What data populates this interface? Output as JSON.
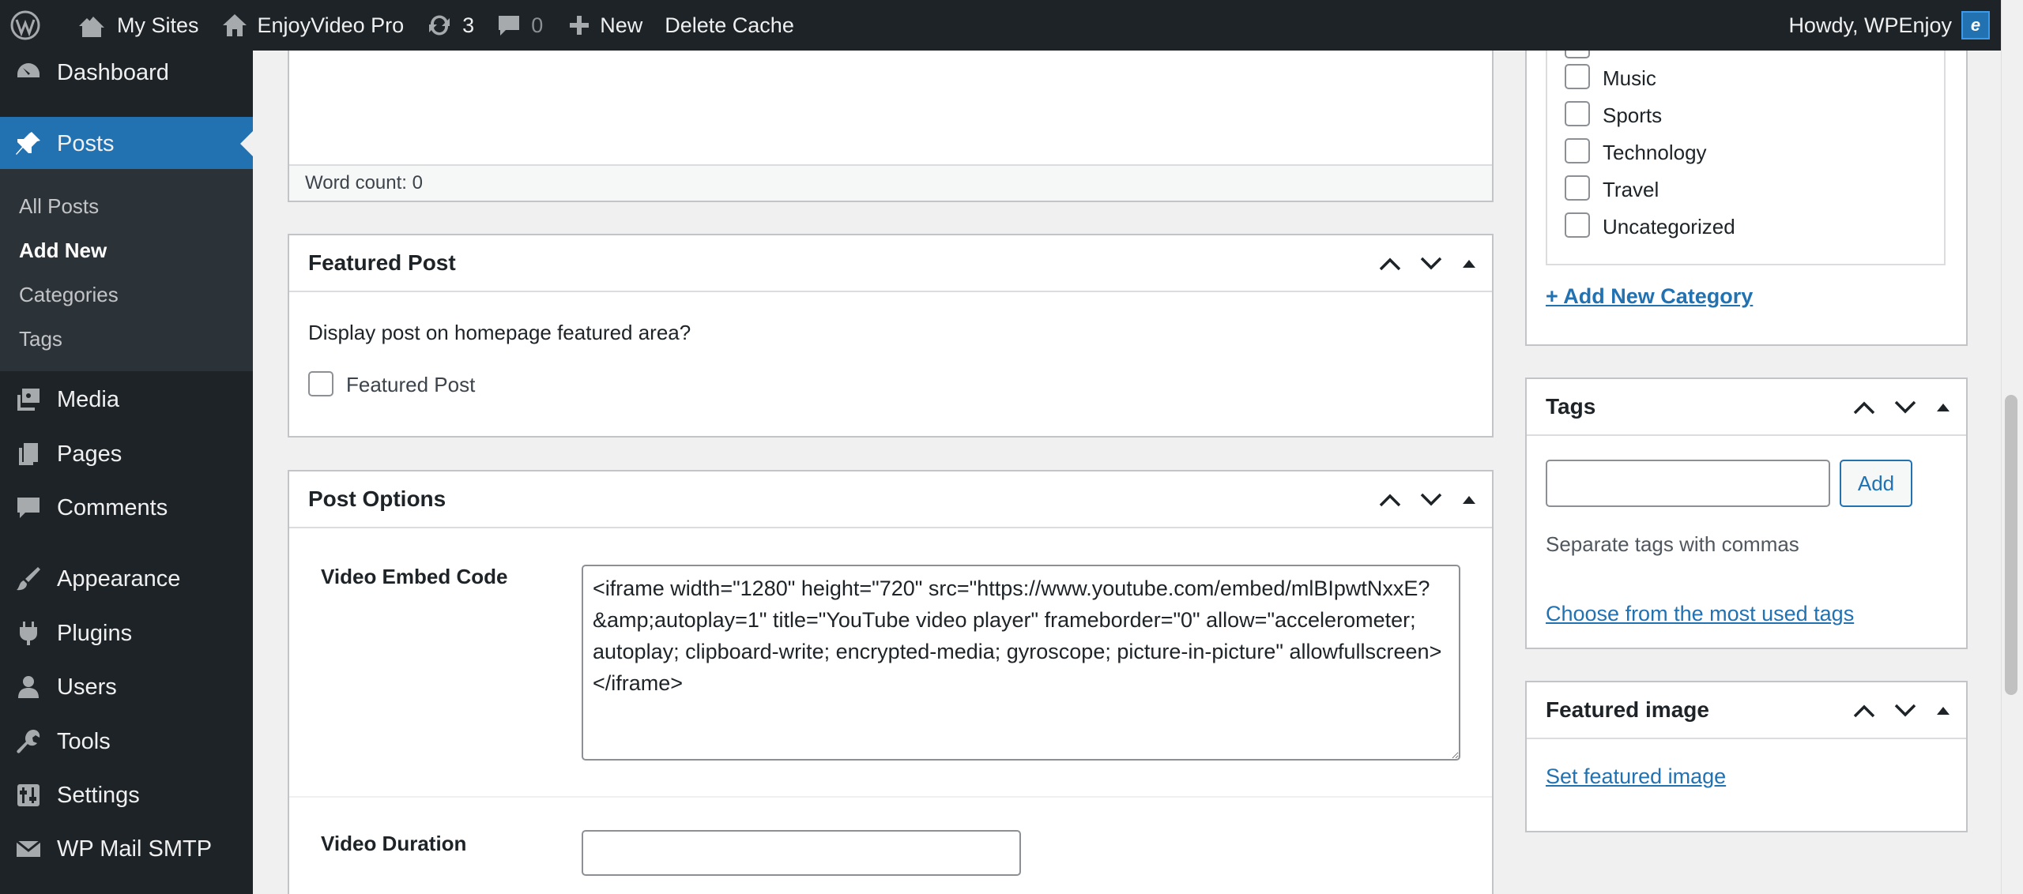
{
  "adminbar": {
    "my_sites": "My Sites",
    "site_name": "EnjoyVideo Pro",
    "updates_count": "3",
    "comments_count": "0",
    "new_label": "New",
    "delete_cache": "Delete Cache",
    "howdy": "Howdy, WPEnjoy"
  },
  "sidebar": {
    "items": [
      {
        "label": "Dashboard",
        "icon": "dashboard-icon"
      },
      {
        "label": "Posts",
        "icon": "pin-icon"
      },
      {
        "label": "Media",
        "icon": "media-icon"
      },
      {
        "label": "Pages",
        "icon": "pages-icon"
      },
      {
        "label": "Comments",
        "icon": "comments-icon"
      },
      {
        "label": "Appearance",
        "icon": "brush-icon"
      },
      {
        "label": "Plugins",
        "icon": "plugin-icon"
      },
      {
        "label": "Users",
        "icon": "users-icon"
      },
      {
        "label": "Tools",
        "icon": "wrench-icon"
      },
      {
        "label": "Settings",
        "icon": "settings-icon"
      },
      {
        "label": "WP Mail SMTP",
        "icon": "mail-icon"
      }
    ],
    "submenu": [
      "All Posts",
      "Add New",
      "Categories",
      "Tags"
    ]
  },
  "editor": {
    "word_count": "Word count: 0"
  },
  "featured_post": {
    "title": "Featured Post",
    "description": "Display post on homepage featured area?",
    "checkbox_label": "Featured Post"
  },
  "post_options": {
    "title": "Post Options",
    "video_embed_label": "Video Embed Code",
    "video_embed_value": "<iframe width=\"1280\" height=\"720\" src=\"https://www.youtube.com/embed/mlBIpwtNxxE?&amp;autoplay=1\" title=\"YouTube video player\" frameborder=\"0\" allow=\"accelerometer; autoplay; clipboard-write; encrypted-media; gyroscope; picture-in-picture\" allowfullscreen></iframe>",
    "video_duration_label": "Video Duration",
    "video_duration_value": ""
  },
  "categories": {
    "items": [
      "Music",
      "Sports",
      "Technology",
      "Travel",
      "Uncategorized"
    ],
    "add_new": "+ Add New Category"
  },
  "tags": {
    "title": "Tags",
    "input_value": "",
    "add_button": "Add",
    "hint": "Separate tags with commas",
    "choose_link": "Choose from the most used tags"
  },
  "featured_image": {
    "title": "Featured image",
    "set_link": "Set featured image"
  },
  "colors": {
    "accent": "#2271b1",
    "adminbar_bg": "#1d2327",
    "submenu_bg": "#2c3338"
  }
}
